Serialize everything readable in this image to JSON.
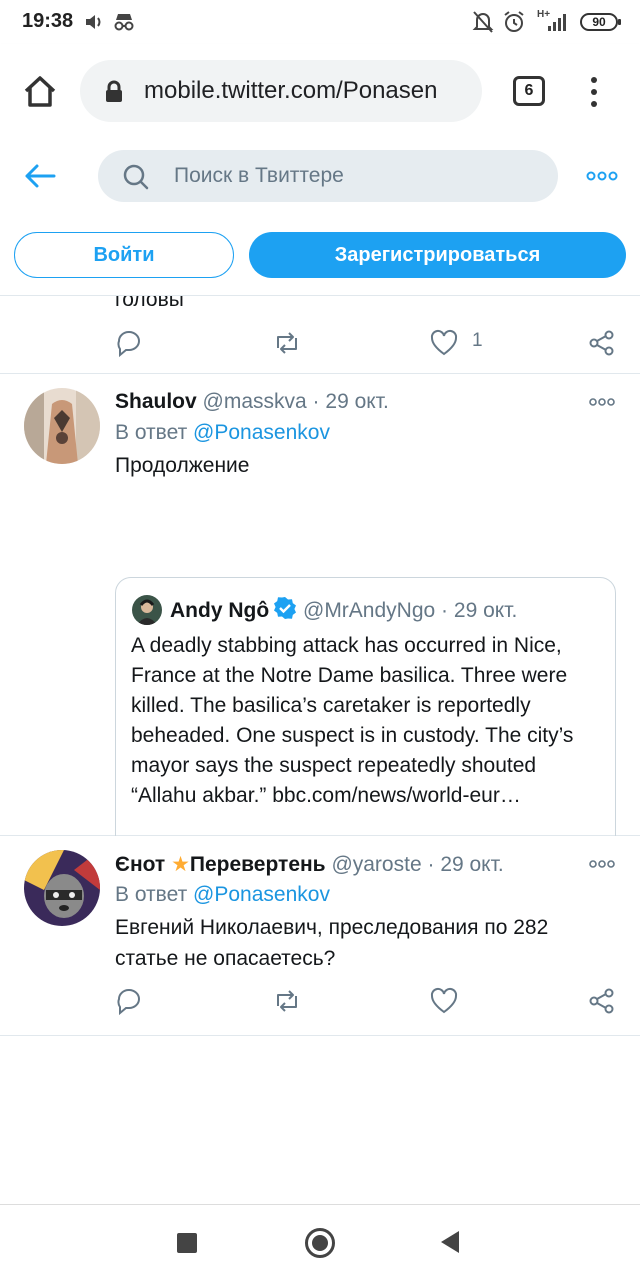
{
  "status_bar": {
    "time": "19:38",
    "network": "H+",
    "battery": "90",
    "icons": [
      "volume-icon",
      "incognito-icon",
      "mute-icon",
      "alarm-icon",
      "signal-icon",
      "battery-icon"
    ]
  },
  "browser": {
    "url": "mobile.twitter.com/Ponasen",
    "tab_count": "6"
  },
  "header": {
    "search_placeholder": "Поиск в Твиттере",
    "login_label": "Войти",
    "signup_label": "Зарегистрироваться"
  },
  "feed": {
    "partial_tweet": {
      "text": "головы",
      "like_count": "1"
    },
    "tweets": [
      {
        "name": "Shaulov",
        "handle": "@masskva",
        "dot": "·",
        "date": "29 окт.",
        "reply_prefix": "В ответ",
        "reply_to": "@Ponasenkov",
        "text": "Продолжение",
        "quote": {
          "name": "Andy Ngô",
          "handle": "@MrAndyNgo",
          "dot": "·",
          "date": "29 окт.",
          "text": "A deadly stabbing attack has occurred in Nice, France at the Notre Dame basilica. Three were killed. The basilica’s caretaker is reportedly beheaded. One suspect is in custody. The city’s mayor says the suspect repeatedly shouted “Allahu akbar.” bbc.com/news/world-eur…"
        }
      },
      {
        "name_part1": "Єнот",
        "name_star": "★",
        "name_part2": "Перевертень",
        "handle": "@yaroste",
        "dot": "·",
        "date": "29 окт.",
        "reply_prefix": "В ответ",
        "reply_to": "@Ponasenkov",
        "text": "Евгений Николаевич, преследования по 282 статье не опасаетесь?"
      }
    ]
  },
  "colors": {
    "twitter_blue": "#1da1f2",
    "link_blue": "#1b95e0",
    "secondary_text": "#657786",
    "divider": "#e1e8ed"
  }
}
